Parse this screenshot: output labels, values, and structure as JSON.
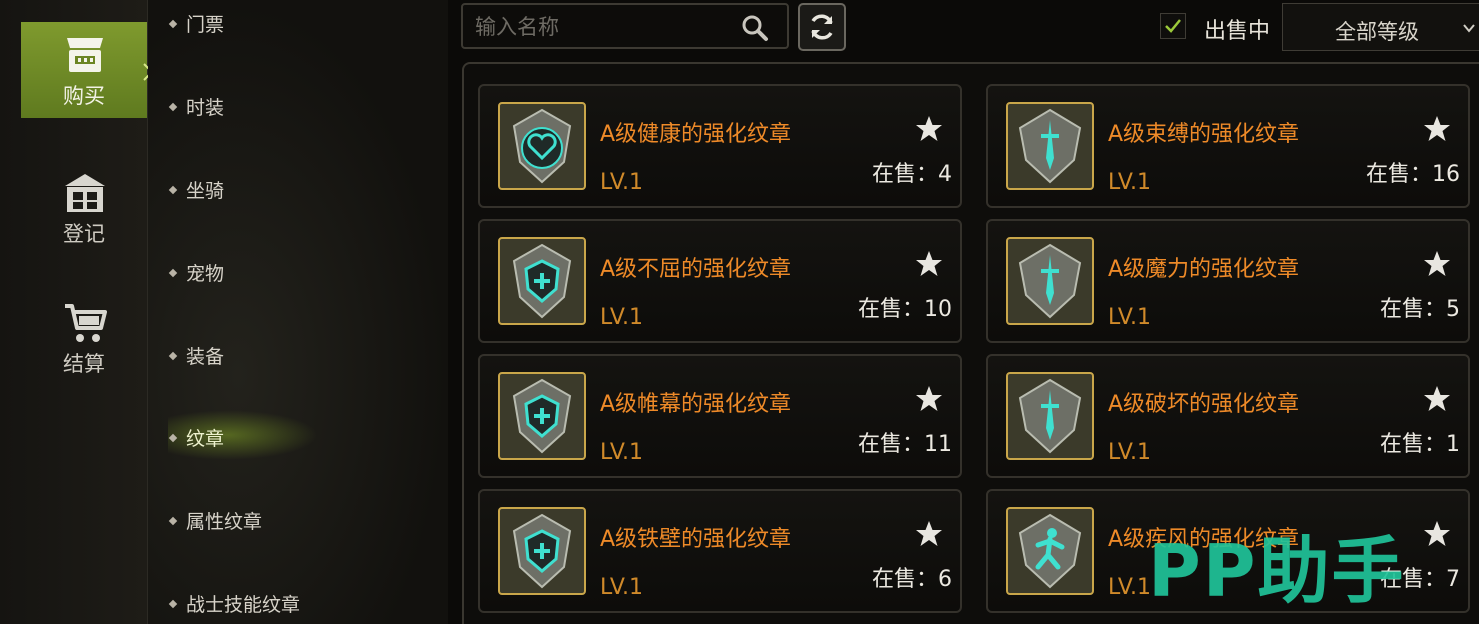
{
  "left_nav": {
    "items": [
      {
        "label": "购买",
        "icon": "store-icon",
        "active": true
      },
      {
        "label": "登记",
        "icon": "register-icon",
        "active": false
      },
      {
        "label": "结算",
        "icon": "cart-icon",
        "active": false
      }
    ]
  },
  "categories": [
    {
      "label": "门票"
    },
    {
      "label": "时装"
    },
    {
      "label": "坐骑"
    },
    {
      "label": "宠物"
    },
    {
      "label": "装备"
    },
    {
      "label": "纹章",
      "selected": true
    },
    {
      "label": "属性纹章"
    },
    {
      "label": "战士技能纹章"
    }
  ],
  "search": {
    "placeholder": "输入名称",
    "value": ""
  },
  "filters": {
    "on_sale_label": "出售中",
    "on_sale_checked": true,
    "grade_value": "全部等级"
  },
  "items": [
    {
      "name": "A级健康的强化纹章",
      "level": "LV.1",
      "stock": "在售：4",
      "icon": "heart-emblem-icon"
    },
    {
      "name": "A级束缚的强化纹章",
      "level": "LV.1",
      "stock": "在售：16",
      "icon": "sword-emblem-icon"
    },
    {
      "name": "A级不屈的强化纹章",
      "level": "LV.1",
      "stock": "在售：10",
      "icon": "shield-emblem-icon"
    },
    {
      "name": "A级魔力的强化纹章",
      "level": "LV.1",
      "stock": "在售：5",
      "icon": "sword-emblem-icon"
    },
    {
      "name": "A级帷幕的强化纹章",
      "level": "LV.1",
      "stock": "在售：11",
      "icon": "shield-emblem-icon"
    },
    {
      "name": "A级破坏的强化纹章",
      "level": "LV.1",
      "stock": "在售：1",
      "icon": "sword-emblem-icon"
    },
    {
      "name": "A级铁壁的强化纹章",
      "level": "LV.1",
      "stock": "在售：6",
      "icon": "shield-emblem-icon"
    },
    {
      "name": "A级疾风的强化纹章",
      "level": "LV.1",
      "stock": "在售：7",
      "icon": "runner-emblem-icon"
    }
  ],
  "watermark": "PP助手",
  "colors": {
    "accent_green": "#7f9a2e",
    "item_name": "#ee8a28",
    "gold_frame": "#c9a64a",
    "emblem_cyan": "#3fe0d0",
    "watermark": "#20c49a"
  }
}
